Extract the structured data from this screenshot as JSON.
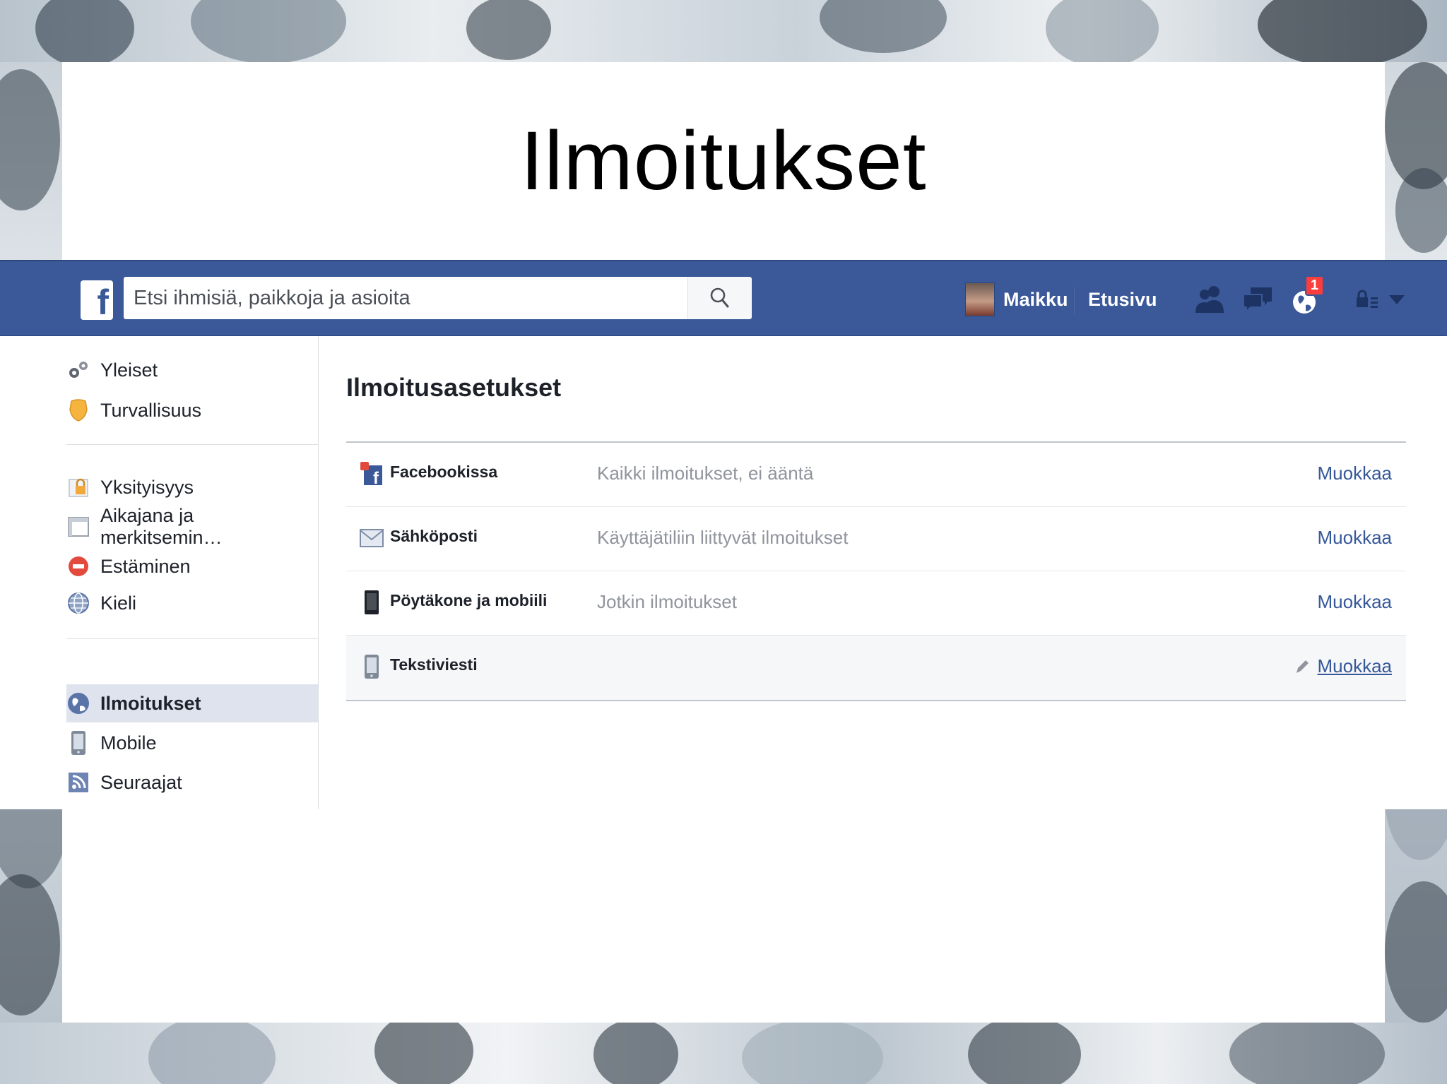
{
  "slide": {
    "title": "Ilmoitukset"
  },
  "header": {
    "search_placeholder": "Etsi ihmisiä, paikkoja ja asioita",
    "profile_name": "Maikku",
    "home_label": "Etusivu",
    "notification_count": "1",
    "brand_color": "#3b5998",
    "icons": [
      "friends-icon",
      "messages-icon",
      "notifications-globe-icon",
      "privacy-lock-icon",
      "dropdown-arrow-icon"
    ]
  },
  "sidebar": {
    "groups": [
      [
        {
          "label": "Yleiset",
          "icon": "gears-icon"
        },
        {
          "label": "Turvallisuus",
          "icon": "badge-icon"
        }
      ],
      [
        {
          "label": "Yksityisyys",
          "icon": "privacy-lock-icon"
        },
        {
          "label": "Aikajana ja merkitsemin…",
          "icon": "timeline-icon"
        },
        {
          "label": "Estäminen",
          "icon": "block-icon"
        },
        {
          "label": "Kieli",
          "icon": "globe-icon"
        }
      ],
      [
        {
          "label": "Ilmoitukset",
          "icon": "notification-globe-icon",
          "active": true
        },
        {
          "label": "Mobile",
          "icon": "phone-icon"
        },
        {
          "label": "Seuraajat",
          "icon": "rss-icon"
        }
      ]
    ]
  },
  "main": {
    "title": "Ilmoitusasetukset",
    "rows": [
      {
        "label": "Facebookissa",
        "desc": "Kaikki ilmoitukset, ei ääntä",
        "edit": "Muokkaa",
        "icon": "facebook-notification-icon"
      },
      {
        "label": "Sähköposti",
        "desc": "Käyttäjätiliin liittyvät ilmoitukset",
        "edit": "Muokkaa",
        "icon": "envelope-icon"
      },
      {
        "label": "Pöytäkone ja mobiili",
        "desc": "Jotkin ilmoitukset",
        "edit": "Muokkaa",
        "icon": "mobile-device-icon"
      },
      {
        "label": "Tekstiviesti",
        "desc": "",
        "edit": "Muokkaa",
        "icon": "sms-phone-icon"
      }
    ]
  }
}
